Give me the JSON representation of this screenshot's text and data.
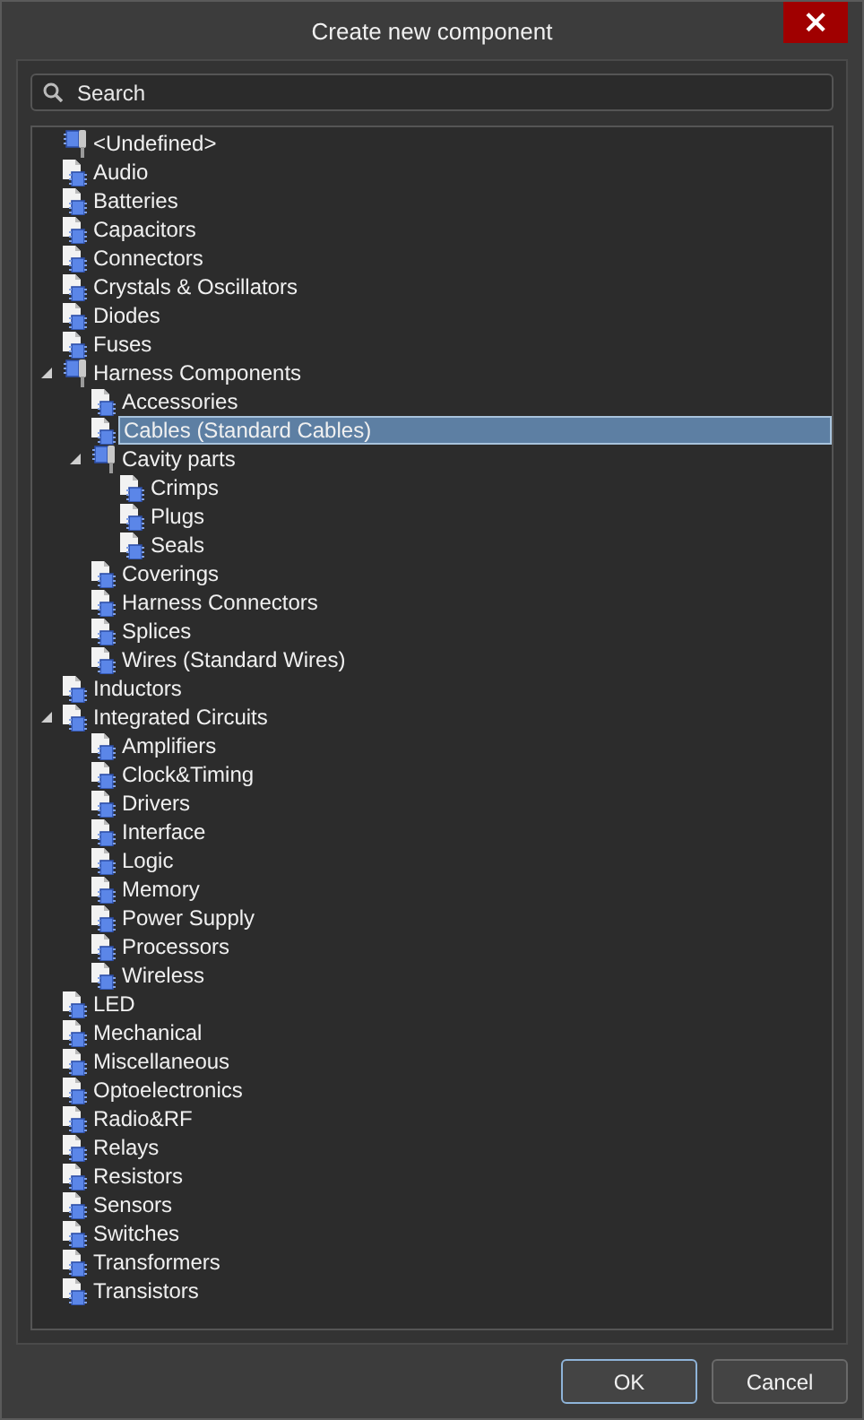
{
  "window": {
    "title": "Create new component",
    "close": "×"
  },
  "search": {
    "placeholder": "Search"
  },
  "tree": [
    {
      "label": "<Undefined>",
      "kind": "connector",
      "selected": false
    },
    {
      "label": "Audio",
      "kind": "part",
      "selected": false
    },
    {
      "label": "Batteries",
      "kind": "part",
      "selected": false
    },
    {
      "label": "Capacitors",
      "kind": "part",
      "selected": false
    },
    {
      "label": "Connectors",
      "kind": "part",
      "selected": false
    },
    {
      "label": "Crystals & Oscillators",
      "kind": "part",
      "selected": false
    },
    {
      "label": "Diodes",
      "kind": "part",
      "selected": false
    },
    {
      "label": "Fuses",
      "kind": "part",
      "selected": false
    },
    {
      "label": "Harness Components",
      "kind": "connector",
      "selected": false,
      "expanded": true,
      "children": [
        {
          "label": "Accessories",
          "kind": "part",
          "selected": false
        },
        {
          "label": "Cables (Standard Cables)",
          "kind": "part",
          "selected": true
        },
        {
          "label": "Cavity parts",
          "kind": "connector",
          "selected": false,
          "expanded": true,
          "children": [
            {
              "label": "Crimps",
              "kind": "part",
              "selected": false
            },
            {
              "label": "Plugs",
              "kind": "part",
              "selected": false
            },
            {
              "label": "Seals",
              "kind": "part",
              "selected": false
            }
          ]
        },
        {
          "label": "Coverings",
          "kind": "part",
          "selected": false
        },
        {
          "label": "Harness Connectors",
          "kind": "part",
          "selected": false
        },
        {
          "label": "Splices",
          "kind": "part",
          "selected": false
        },
        {
          "label": "Wires (Standard Wires)",
          "kind": "part",
          "selected": false
        }
      ]
    },
    {
      "label": "Inductors",
      "kind": "part",
      "selected": false
    },
    {
      "label": "Integrated Circuits",
      "kind": "part",
      "selected": false,
      "expanded": true,
      "children": [
        {
          "label": "Amplifiers",
          "kind": "part",
          "selected": false
        },
        {
          "label": "Clock&Timing",
          "kind": "part",
          "selected": false
        },
        {
          "label": "Drivers",
          "kind": "part",
          "selected": false
        },
        {
          "label": "Interface",
          "kind": "part",
          "selected": false
        },
        {
          "label": "Logic",
          "kind": "part",
          "selected": false
        },
        {
          "label": "Memory",
          "kind": "part",
          "selected": false
        },
        {
          "label": "Power Supply",
          "kind": "part",
          "selected": false
        },
        {
          "label": "Processors",
          "kind": "part",
          "selected": false
        },
        {
          "label": "Wireless",
          "kind": "part",
          "selected": false
        }
      ]
    },
    {
      "label": "LED",
      "kind": "part",
      "selected": false
    },
    {
      "label": "Mechanical",
      "kind": "part",
      "selected": false
    },
    {
      "label": "Miscellaneous",
      "kind": "part",
      "selected": false
    },
    {
      "label": "Optoelectronics",
      "kind": "part",
      "selected": false
    },
    {
      "label": "Radio&RF",
      "kind": "part",
      "selected": false
    },
    {
      "label": "Relays",
      "kind": "part",
      "selected": false
    },
    {
      "label": "Resistors",
      "kind": "part",
      "selected": false
    },
    {
      "label": "Sensors",
      "kind": "part",
      "selected": false
    },
    {
      "label": "Switches",
      "kind": "part",
      "selected": false
    },
    {
      "label": "Transformers",
      "kind": "part",
      "selected": false
    },
    {
      "label": "Transistors",
      "kind": "part",
      "selected": false
    }
  ],
  "buttons": [
    {
      "label": "OK",
      "default": true
    },
    {
      "label": "Cancel",
      "default": false
    }
  ]
}
